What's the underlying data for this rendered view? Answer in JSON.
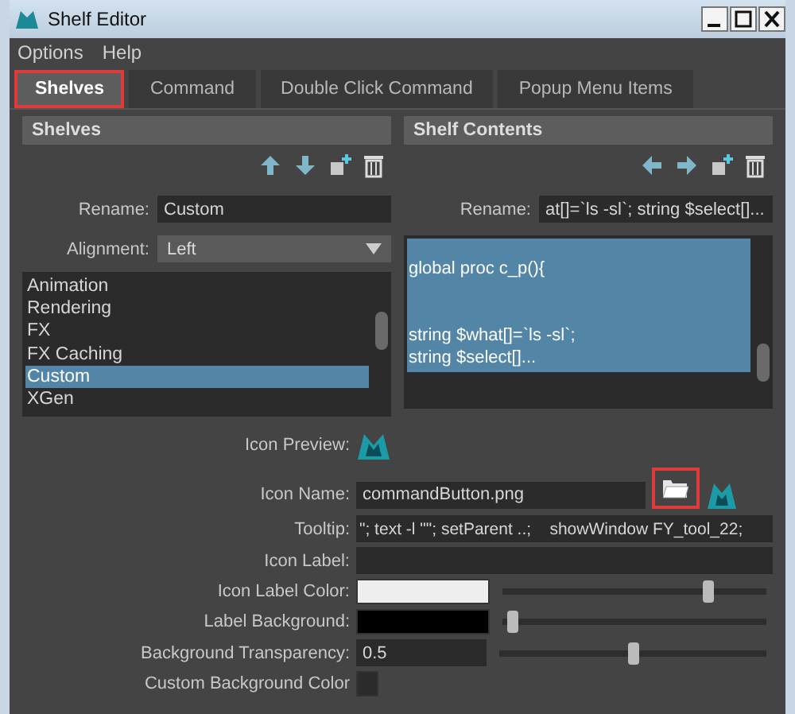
{
  "window": {
    "title": "Shelf Editor"
  },
  "menu": [
    "Options",
    "Help"
  ],
  "tabs": [
    {
      "label": "Shelves",
      "selected": true,
      "highlighted": true
    },
    {
      "label": "Command",
      "selected": false,
      "highlighted": false
    },
    {
      "label": "Double Click Command",
      "selected": false,
      "highlighted": false
    },
    {
      "label": "Popup Menu Items",
      "selected": false,
      "highlighted": false
    }
  ],
  "shelves_panel": {
    "title": "Shelves",
    "rename": {
      "label": "Rename:",
      "value": "Custom"
    },
    "alignment": {
      "label": "Alignment:",
      "value": "Left"
    },
    "items": [
      {
        "label": "Animation",
        "selected": false
      },
      {
        "label": "Rendering",
        "selected": false
      },
      {
        "label": "FX",
        "selected": false
      },
      {
        "label": "FX Caching",
        "selected": false
      },
      {
        "label": "Custom",
        "selected": true
      },
      {
        "label": "XGen",
        "selected": false
      }
    ]
  },
  "contents_panel": {
    "title": "Shelf Contents",
    "rename": {
      "label": "Rename:",
      "value": "at[]=`ls -sl`; string $select[]..."
    },
    "items": [
      {
        "blocks": [
          [
            "global proc  c_p(){"
          ],
          [
            "string $what[]=`ls -sl`;",
            "string $select[]..."
          ]
        ],
        "selected": true
      }
    ]
  },
  "icon_preview": {
    "label": "Icon Preview:"
  },
  "icon_name": {
    "label": "Icon Name:",
    "value": "commandButton.png",
    "browse_highlighted": true
  },
  "tooltip": {
    "label": "Tooltip:",
    "value": "\"; text -l \"\"; setParent ..;    showWindow FY_tool_22;"
  },
  "icon_label": {
    "label": "Icon Label:"
  },
  "color_rows": [
    {
      "label": "Icon Label Color:",
      "color": "#eeeeee",
      "level": 0.79
    },
    {
      "label": "Label Background:",
      "color": "#000000",
      "level": 0.02
    }
  ],
  "background_transparency": {
    "label": "Background Transparency:",
    "value": "0.5",
    "level": 0.5
  },
  "custom_background_color": {
    "label": "Custom Background Color"
  }
}
